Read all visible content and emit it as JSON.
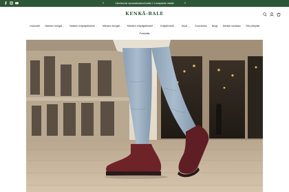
{
  "announcement": {
    "message": "Lähetämme samanaikaisesti kaikki 1-3 arkipäivän sisällä",
    "prev_icon": "chevron-left-icon",
    "next_icon": "chevron-right-icon"
  },
  "social": [
    "facebook-icon",
    "instagram-icon",
    "youtube-icon"
  ],
  "brand": {
    "name": "KENKÄ-BALE",
    "color": "#2e5737"
  },
  "header_icons": [
    "search-icon",
    "account-icon",
    "cart-icon"
  ],
  "nav": {
    "items": [
      {
        "label": "Uutuudet",
        "has_dropdown": false
      },
      {
        "label": "Naisten kengät",
        "has_dropdown": true
      },
      {
        "label": "Naisten erityisjalkineet",
        "has_dropdown": true
      },
      {
        "label": "Miesten kengät",
        "has_dropdown": true
      },
      {
        "label": "Miesten erityisjalkineet",
        "has_dropdown": true
      },
      {
        "label": "Kotijalkineet",
        "has_dropdown": true
      },
      {
        "label": "Muut",
        "has_dropdown": true
      },
      {
        "label": "Suomessa",
        "has_dropdown": false
      },
      {
        "label": "Blogi",
        "has_dropdown": false
      },
      {
        "label": "Meistä meidasa",
        "has_dropdown": false
      },
      {
        "label": "Ota yhteyttä",
        "has_dropdown": false
      }
    ],
    "second_row": "Poistotila"
  },
  "hero": {
    "image_icon": "hero-photo",
    "colors": {
      "sky": "#e9e2d6",
      "building": "#b8a890",
      "pavement": "#c8b69f",
      "jeans": "#9aaec0",
      "shoe": "#6e2329"
    }
  }
}
